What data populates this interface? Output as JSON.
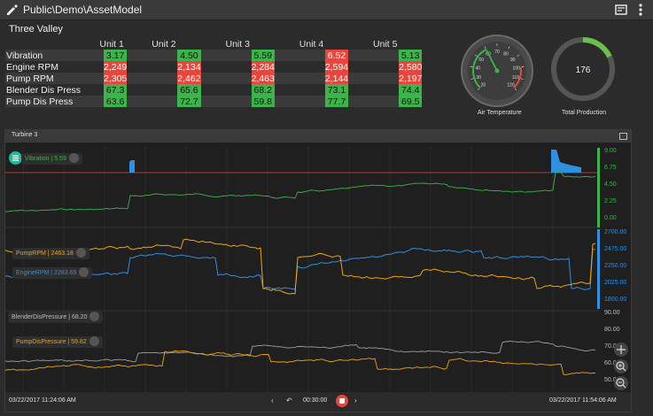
{
  "header": {
    "path": "Public\\Demo\\AssetModel"
  },
  "site_title": "Three Valley",
  "units": [
    "Unit 1",
    "Unit 2",
    "Unit 3",
    "Unit 4",
    "Unit 5"
  ],
  "rows": [
    {
      "label": "Vibration",
      "values": [
        "3.17",
        "4.50",
        "5.59",
        "6.52",
        "5.13"
      ],
      "status": [
        "good",
        "good",
        "good",
        "bad",
        "good"
      ]
    },
    {
      "label": "Engine RPM",
      "values": [
        "2,249",
        "2,134",
        "2,284",
        "2,594",
        "2,580"
      ],
      "status": [
        "bad",
        "bad",
        "bad",
        "bad",
        "bad"
      ]
    },
    {
      "label": "Pump RPM",
      "values": [
        "2,305",
        "2,462",
        "2,463",
        "2,144",
        "2,197"
      ],
      "status": [
        "bad",
        "bad",
        "bad",
        "bad",
        "bad"
      ]
    },
    {
      "label": "Blender Dis Press",
      "values": [
        "67.3",
        "65.6",
        "68.2",
        "73.1",
        "74.4"
      ],
      "status": [
        "good",
        "good",
        "good",
        "good",
        "good"
      ]
    },
    {
      "label": "Pump Dis Press",
      "values": [
        "63.6",
        "72.7",
        "59.8",
        "77.7",
        "69.5"
      ],
      "status": [
        "good",
        "good",
        "good",
        "good",
        "good"
      ]
    }
  ],
  "gauge": {
    "label": "Air Temperature",
    "ticks": [
      "20",
      "30",
      "40",
      "50",
      "60",
      "70",
      "80",
      "90",
      "100",
      "110",
      "120"
    ],
    "value": 60,
    "min": 20,
    "max": 120
  },
  "production": {
    "label": "Total Production",
    "value": "176",
    "fill_fraction": 0.18
  },
  "trend": {
    "title": "Turbine 3",
    "tags": {
      "vibration": "Vibration | 5.59",
      "pump_rpm": "PumpRPM | 2463.18",
      "engine_rpm": "EngineRPM | 2283.69",
      "blender": "BlenderDisPressure | 68.20",
      "pump_dis": "PumpDisPressure | 59.82"
    },
    "vib_ticks": [
      "9.00",
      "6.75",
      "4.50",
      "2.25",
      "0.00"
    ],
    "rpm_ticks": [
      "2700.00",
      "2475.00",
      "2250.00",
      "2025.00",
      "1800.00"
    ],
    "press_ticks": [
      "90.00",
      "80.00",
      "70.00",
      "60.00",
      "50.00"
    ],
    "time_start": "03/22/2017 11:24:06 AM",
    "time_end": "03/22/2017 11:54:06 AM",
    "duration": "00:30:00"
  },
  "colors": {
    "good": "#3cb44b",
    "bad": "#e8453c",
    "vibration": "#3cb44b",
    "pump": "#f0a30a",
    "engine": "#2f8fe0",
    "blender": "#9e9e9e",
    "limit": "#e8453c"
  }
}
